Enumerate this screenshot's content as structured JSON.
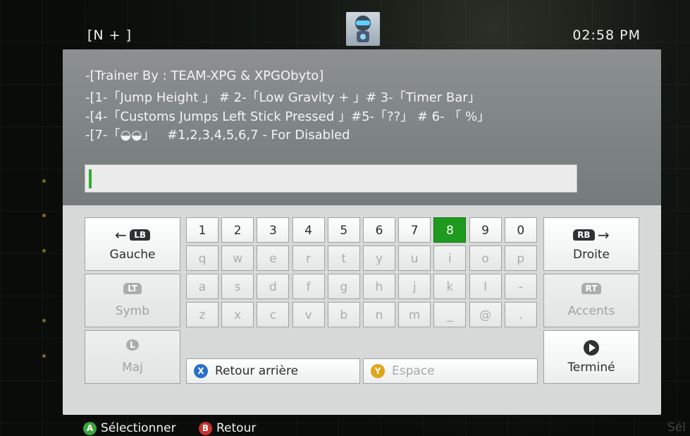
{
  "topbar": {
    "tag": "[N + ]",
    "time": "02:58  PM"
  },
  "dialog": {
    "message_lines": [
      "-[Trainer By : TEAM-XPG & XPGObyto]",
      "-[1-「Jump Height 」 # 2-「Low Gravity + 」# 3-「Timer Bar」",
      "-[4-「Customs Jumps Left Stick Pressed 」#5-「??」 # 6- 「 %」",
      "-[7-「◒◒」   #1,2,3,4,5,6,7 - For Disabled"
    ],
    "input_value": ""
  },
  "keyboard": {
    "rows": [
      [
        "1",
        "2",
        "3",
        "4",
        "5",
        "6",
        "7",
        "8",
        "9",
        "0"
      ],
      [
        "q",
        "w",
        "e",
        "r",
        "t",
        "y",
        "u",
        "i",
        "o",
        "p"
      ],
      [
        "a",
        "s",
        "d",
        "f",
        "g",
        "h",
        "j",
        "k",
        "l",
        "-"
      ],
      [
        "z",
        "x",
        "c",
        "v",
        "b",
        "n",
        "m",
        "_",
        "@",
        "."
      ]
    ],
    "selected_key": "8",
    "left_keys": {
      "gauche": {
        "label": "Gauche",
        "bumper": "LB"
      },
      "symb": {
        "label": "Symb",
        "bumper": "LT"
      },
      "maj": {
        "label": "Maj",
        "bumper": "L"
      }
    },
    "right_keys": {
      "droite": {
        "label": "Droite",
        "bumper": "RB"
      },
      "accents": {
        "label": "Accents",
        "bumper": "RT"
      },
      "termine": {
        "label": "Terminé"
      }
    },
    "backspace": {
      "label": "Retour arrière",
      "button": "X"
    },
    "space": {
      "label": "Espace",
      "button": "Y"
    }
  },
  "footer": {
    "select": {
      "button": "A",
      "label": "Sélectionner"
    },
    "back": {
      "button": "B",
      "label": "Retour"
    },
    "corner_text": "Sél"
  },
  "colors": {
    "selected_key": "#1e9a1e",
    "caret": "#2fae2f",
    "button_a": "#3aa63a",
    "button_b": "#c8322c",
    "button_x": "#2a6fc9",
    "button_y": "#e0a51a"
  }
}
